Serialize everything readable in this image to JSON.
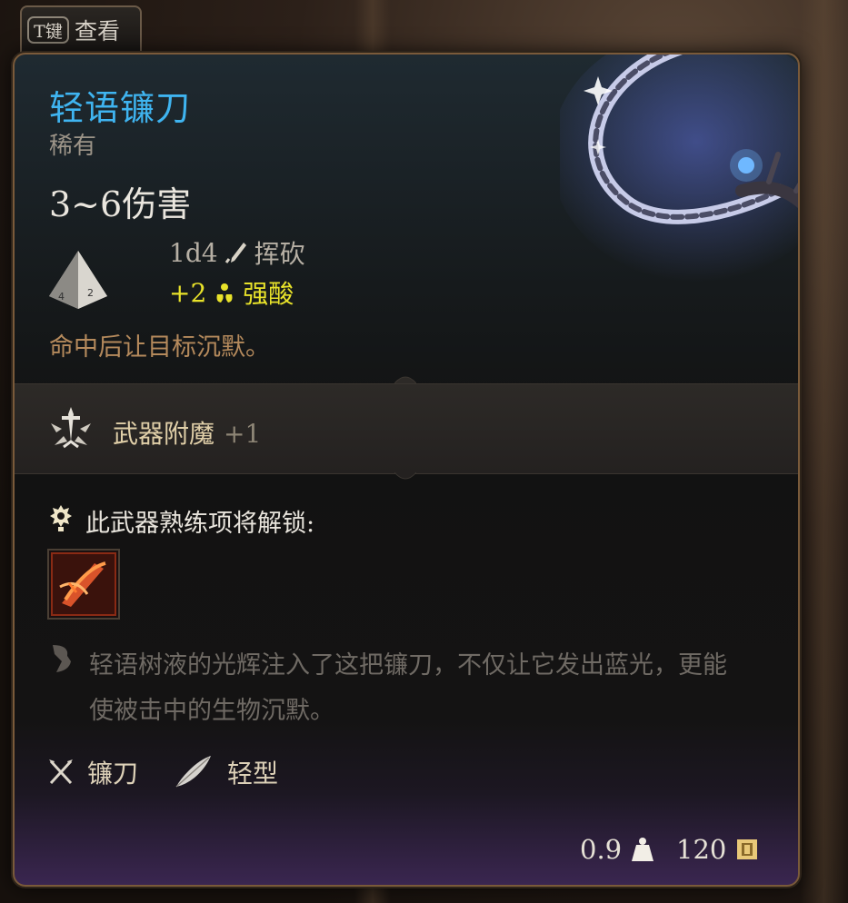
{
  "hotkey": {
    "key": "T键",
    "label": "查看"
  },
  "item": {
    "name": "轻语镰刀",
    "rarity": "稀有",
    "damage_total": "3~6伤害",
    "damage_lines": [
      {
        "dice": "1d4",
        "type": "挥砍",
        "icon": "slashing-icon",
        "color": "#b6afa4"
      },
      {
        "dice": "+2",
        "type": "强酸",
        "icon": "acid-icon",
        "color": "#e8e22a"
      }
    ],
    "on_hit": "命中后让目标沉默。"
  },
  "enchant": {
    "label": "武器附魔",
    "value": "+1",
    "icon": "weapon-enchant-icon"
  },
  "proficiency": {
    "label": "此武器熟练项将解锁:",
    "skill_icon": "slash-skill-icon"
  },
  "lore": "轻语树液的光辉注入了这把镰刀，不仅让它发出蓝光，更能使被击中的生物沉默。",
  "tags": [
    {
      "label": "镰刀",
      "icon": "sickle-icon"
    },
    {
      "label": "轻型",
      "icon": "feather-icon"
    }
  ],
  "footer": {
    "weight": "0.9",
    "weight_icon": "weight-icon",
    "price": "120",
    "price_icon": "coin-icon"
  },
  "colors": {
    "name": "#3fb4f0",
    "acid": "#e8e22a",
    "effect": "#b58a5c",
    "lore": "#6f6a64"
  }
}
